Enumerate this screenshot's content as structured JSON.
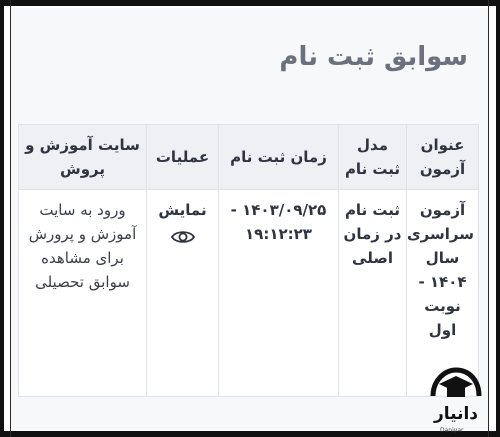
{
  "page": {
    "title": "سوابق ثبت نام"
  },
  "table": {
    "headers": {
      "exam_title": "عنوان آزمون",
      "registration_model": "مدل ثبت نام",
      "registration_time": "زمان ثبت نام",
      "operations": "عملیات",
      "education_site": "سایت آموزش و پروش"
    },
    "row": {
      "exam_title": "آزمون سراسری سال ۱۴۰۴ - نوبت اول",
      "registration_model": "ثبت نام در زمان اصلی",
      "registration_time": "۱۴۰۳/۰۹/۲۵ - ۱۹:۱۲:۲۳",
      "operations_label": "نمایش",
      "operations_icon": "eye-icon",
      "education_site": "ورود به سایت آموزش و پرورش برای مشاهده سوابق تحصیلی"
    }
  },
  "watermark": {
    "text": "دانیار",
    "subtext": "Daniyar"
  },
  "colors": {
    "accent": "#3b6fd8",
    "title": "#6b717d",
    "header_bg": "#eef0f4"
  }
}
